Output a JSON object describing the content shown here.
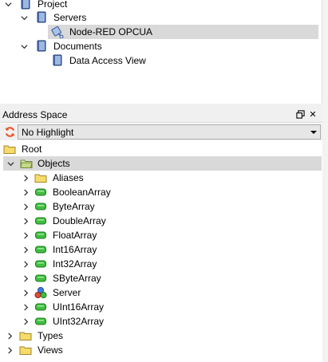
{
  "project_tree": {
    "items": [
      {
        "label": "Project",
        "level": 0,
        "expanded": true,
        "icon": "book-icon"
      },
      {
        "label": "Servers",
        "level": 1,
        "expanded": true,
        "icon": "book-icon"
      },
      {
        "label": "Node-RED OPCUA",
        "level": 2,
        "selected": true,
        "icon": "server-connection-icon"
      },
      {
        "label": "Documents",
        "level": 1,
        "expanded": true,
        "icon": "book-icon"
      },
      {
        "label": "Data Access View",
        "level": 2,
        "icon": "book-icon"
      }
    ]
  },
  "address_space": {
    "title": "Address Space",
    "float_button_icon": "float-window-icon",
    "close_button_label": "✕",
    "refresh_icon": "refresh-icon",
    "highlight_select": {
      "value": "No Highlight"
    },
    "tree": [
      {
        "label": "Root",
        "level": 0,
        "icon": "folder-icon",
        "expanded": true
      },
      {
        "label": "Objects",
        "level": 1,
        "icon": "folder-open-icon",
        "expanded": true,
        "selected": true
      },
      {
        "label": "Aliases",
        "level": 2,
        "icon": "folder-icon",
        "expandable": true
      },
      {
        "label": "BooleanArray",
        "level": 2,
        "icon": "variable-icon",
        "expandable": true
      },
      {
        "label": "ByteArray",
        "level": 2,
        "icon": "variable-icon",
        "expandable": true
      },
      {
        "label": "DoubleArray",
        "level": 2,
        "icon": "variable-icon",
        "expandable": true
      },
      {
        "label": "FloatArray",
        "level": 2,
        "icon": "variable-icon",
        "expandable": true
      },
      {
        "label": "Int16Array",
        "level": 2,
        "icon": "variable-icon",
        "expandable": true
      },
      {
        "label": "Int32Array",
        "level": 2,
        "icon": "variable-icon",
        "expandable": true
      },
      {
        "label": "SByteArray",
        "level": 2,
        "icon": "variable-icon",
        "expandable": true
      },
      {
        "label": "Server",
        "level": 2,
        "icon": "server-object-icon",
        "expandable": true
      },
      {
        "label": "UInt16Array",
        "level": 2,
        "icon": "variable-icon",
        "expandable": true
      },
      {
        "label": "UInt32Array",
        "level": 2,
        "icon": "variable-icon",
        "expandable": true
      },
      {
        "label": "Types",
        "level": 1,
        "icon": "folder-icon",
        "expandable": true
      },
      {
        "label": "Views",
        "level": 1,
        "icon": "folder-icon",
        "expandable": true
      }
    ]
  },
  "colors": {
    "folder": "#e8c84a",
    "variable": "#3fbf3f",
    "book": "#3a5fa0",
    "selection": "#d9d9d9",
    "refresh": "#e8542a"
  }
}
